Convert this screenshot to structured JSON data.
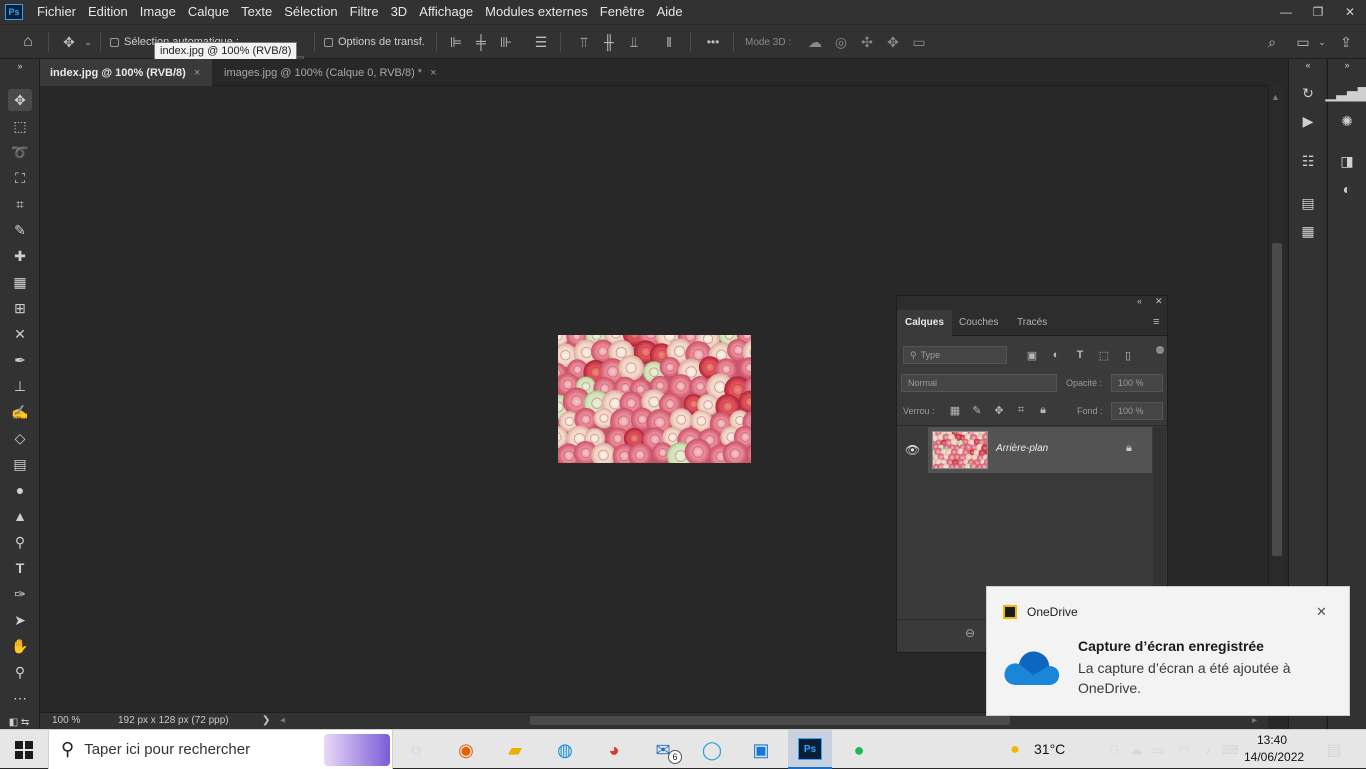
{
  "app": {
    "logo": "Ps",
    "menu": [
      "Fichier",
      "Edition",
      "Image",
      "Calque",
      "Texte",
      "Sélection",
      "Filtre",
      "3D",
      "Affichage",
      "Modules externes",
      "Fenêtre",
      "Aide"
    ]
  },
  "window_controls": {
    "minimize": "—",
    "restore": "❐",
    "close": "✕"
  },
  "options_bar": {
    "auto_select_label": "Sélection automatique :",
    "transform_options_label": "Options de transf.",
    "mode3d_label": "Mode 3D :",
    "more_label": "•••",
    "tooltip": "index.jpg @ 100% (RVB/8)"
  },
  "tabs": [
    {
      "label": "index.jpg @ 100% (RVB/8)",
      "close": "×",
      "active": true
    },
    {
      "label": "images.jpg @ 100% (Calque 0, RVB/8) *",
      "close": "×",
      "active": false
    }
  ],
  "status": {
    "zoom": "100 %",
    "doc_info": "192 px x 128 px (72 ppp)",
    "arrow": "❯"
  },
  "layers_panel": {
    "tabs": [
      "Calques",
      "Couches",
      "Tracés"
    ],
    "filter_placeholder": "Type",
    "blend_mode": "Normal",
    "opacity_label": "Opacité :",
    "opacity_value": "100 %",
    "lock_label": "Verrou :",
    "fill_label": "Fond :",
    "fill_value": "100 %",
    "layer_name": "Arrière-plan"
  },
  "toast": {
    "app_name": "OneDrive",
    "title": "Capture d’écran enregistrée",
    "body": "La capture d’écran a été ajoutée à OneDrive.",
    "close": "✕"
  },
  "taskbar": {
    "search_placeholder": "Taper ici pour rechercher",
    "weather": "31°C",
    "time": "13:40",
    "date": "14/06/2022",
    "mail_badge": "6"
  }
}
